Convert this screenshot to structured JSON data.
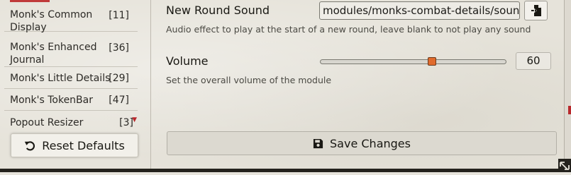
{
  "sidebar": {
    "modules": [
      {
        "name": "Monk's Common Display",
        "count": "[11]"
      },
      {
        "name": "Monk's Enhanced Journal",
        "count": "[36]"
      },
      {
        "name": "Monk's Little Details",
        "count": "[29]"
      },
      {
        "name": "Monk's TokenBar",
        "count": "[47]"
      },
      {
        "name": "Popout Resizer",
        "count": "[3]"
      }
    ],
    "reset_label": "Reset Defaults"
  },
  "settings": {
    "new_round_sound": {
      "label": "New Round Sound",
      "value": "modules/monks-combat-details/sounds/",
      "hint": "Audio effect to play at the start of a new round, leave blank to not play any sound"
    },
    "volume": {
      "label": "Volume",
      "value": 60,
      "value_text": "60",
      "min": 0,
      "max": 100,
      "hint": "Set the overall volume of the module"
    }
  },
  "footer": {
    "save_label": "Save Changes"
  },
  "icons": {
    "reset": "undo-icon",
    "file_picker": "file-import-icon",
    "save": "floppy-disk-icon",
    "scroll_down": "caret-down-icon",
    "resize": "resize-handle-icon"
  },
  "colors": {
    "accent": "#e06b2d",
    "scroll_indicator": "#b8282c",
    "background": "#e6e3da"
  }
}
